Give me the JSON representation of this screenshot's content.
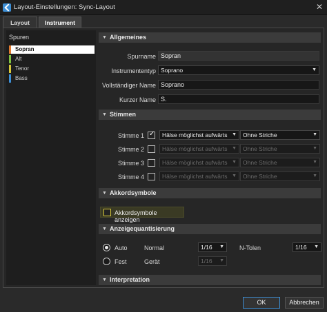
{
  "window": {
    "title": "Layout-Einstellungen: Sync-Layout"
  },
  "tabs": [
    {
      "label": "Layout"
    },
    {
      "label": "Instrument"
    }
  ],
  "sidebar": {
    "title": "Spuren",
    "tracks": [
      {
        "label": "Sopran",
        "color": "#e07a30"
      },
      {
        "label": "Alt",
        "color": "#7fc240"
      },
      {
        "label": "Tenor",
        "color": "#d8c83a"
      },
      {
        "label": "Bass",
        "color": "#3d8fd6"
      }
    ]
  },
  "general": {
    "header": "Allgemeines",
    "track_name_label": "Spurname",
    "track_name_value": "Sopran",
    "instrument_type_label": "Instrumententyp",
    "instrument_type_value": "Soprano",
    "full_name_label": "Vollständiger Name",
    "full_name_value": "Soprano",
    "short_name_label": "Kurzer Name",
    "short_name_value": "S."
  },
  "voices": {
    "header": "Stimmen",
    "rows": [
      {
        "label": "Stimme 1",
        "checked": true,
        "stems": "Hälse möglichst aufwärts",
        "rests": "Ohne Striche"
      },
      {
        "label": "Stimme 2",
        "checked": false,
        "stems": "Hälse möglichst aufwärts",
        "rests": "Ohne Striche"
      },
      {
        "label": "Stimme 3",
        "checked": false,
        "stems": "Hälse möglichst aufwärts",
        "rests": "Ohne Striche"
      },
      {
        "label": "Stimme 4",
        "checked": false,
        "stems": "Hälse möglichst aufwärts",
        "rests": "Ohne Striche"
      }
    ]
  },
  "chords": {
    "header": "Akkordsymbole",
    "show_label": "Akkordsymbole anzeigen"
  },
  "quant": {
    "header": "Anzeigequantisierung",
    "auto_label": "Auto",
    "fixed_label": "Fest",
    "normal_label": "Normal",
    "normal_value": "1/16",
    "ntuplet_label": "N-Tolen",
    "ntuplet_value": "1/16",
    "device_label": "Gerät",
    "device_value": "1/16"
  },
  "interpretation": {
    "header": "Interpretation"
  },
  "footer": {
    "ok_label": "OK",
    "cancel_label": "Abbrechen"
  }
}
